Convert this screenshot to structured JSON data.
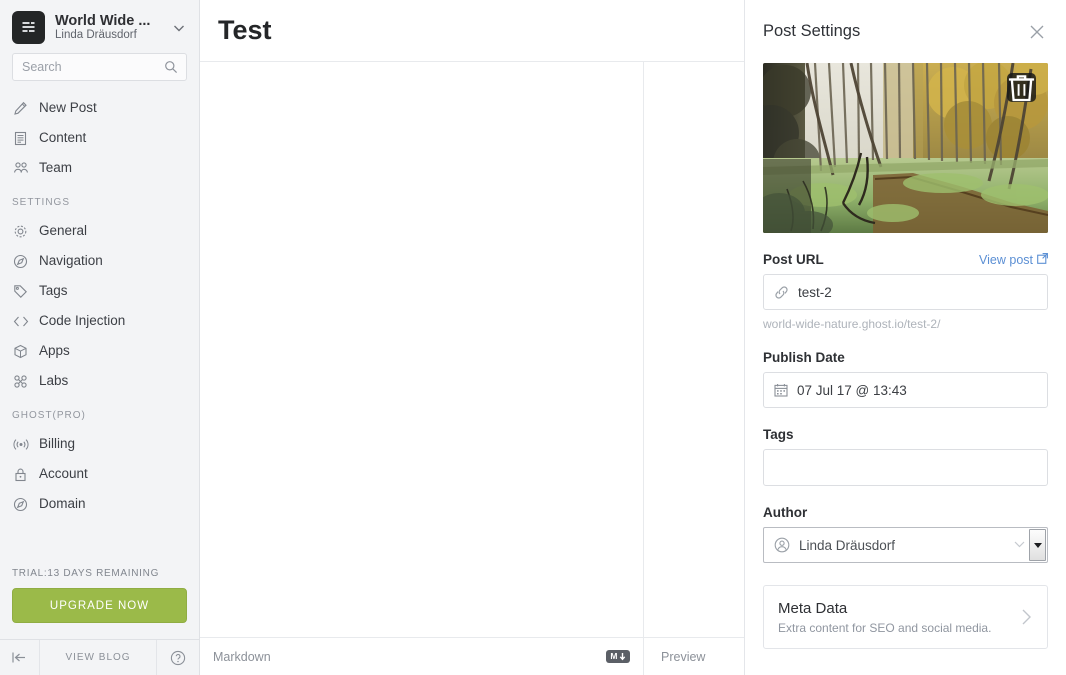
{
  "sidebar": {
    "brand": {
      "title": "World Wide ...",
      "user": "Linda Dräusdorf",
      "logo_icon": "blog-list-icon",
      "caret_icon": "chevron-down-icon"
    },
    "search": {
      "placeholder": "Search",
      "value": "",
      "icon": "search-icon"
    },
    "primary_items": [
      {
        "label": "New Post",
        "icon": "pencil-icon"
      },
      {
        "label": "Content",
        "icon": "document-icon"
      },
      {
        "label": "Team",
        "icon": "people-icon"
      }
    ],
    "settings_heading": "SETTINGS",
    "settings_items": [
      {
        "label": "General",
        "icon": "gear-icon"
      },
      {
        "label": "Navigation",
        "icon": "compass-icon"
      },
      {
        "label": "Tags",
        "icon": "tag-icon"
      },
      {
        "label": "Code Injection",
        "icon": "code-icon"
      },
      {
        "label": "Apps",
        "icon": "box-icon"
      },
      {
        "label": "Labs",
        "icon": "labs-icon"
      }
    ],
    "pro_heading": "GHOST(PRO)",
    "pro_items": [
      {
        "label": "Billing",
        "icon": "broadcast-icon"
      },
      {
        "label": "Account",
        "icon": "lock-icon"
      },
      {
        "label": "Domain",
        "icon": "compass-icon"
      }
    ],
    "trial_text": "TRIAL:13 DAYS REMAINING",
    "upgrade_label": "UPGRADE NOW",
    "upgrade_color": "#9bba49",
    "footer": {
      "collapse_icon": "collapse-left-icon",
      "view_blog_label": "VIEW BLOG",
      "help_icon": "help-circle-icon"
    }
  },
  "editor": {
    "post_title": "Test",
    "content": "",
    "markdown_label": "Markdown",
    "markdown_badge": "M",
    "preview_label": "Preview"
  },
  "settings_panel": {
    "title": "Post Settings",
    "close_icon": "close-icon",
    "featured_image": {
      "alt": "autumn forest swamp with green duckweed water",
      "delete_icon": "trash-icon"
    },
    "post_url": {
      "label": "Post URL",
      "view_post_label": "View post",
      "view_post_icon": "external-link-icon",
      "link_icon": "link-icon",
      "value": "test-2",
      "full_url": "world-wide-nature.ghost.io/test-2/",
      "link_color": "#5b8fd4"
    },
    "publish_date": {
      "label": "Publish Date",
      "calendar_icon": "calendar-icon",
      "value": "07 Jul 17 @ 13:43"
    },
    "tags": {
      "label": "Tags",
      "value": ""
    },
    "author": {
      "label": "Author",
      "avatar_icon": "person-circle-icon",
      "selected": "Linda Dräusdorf",
      "dropdown_icon": "select-arrow-icon"
    },
    "meta_data": {
      "title": "Meta Data",
      "subtitle": "Extra content for SEO and social media.",
      "chevron_icon": "chevron-right-icon"
    }
  }
}
